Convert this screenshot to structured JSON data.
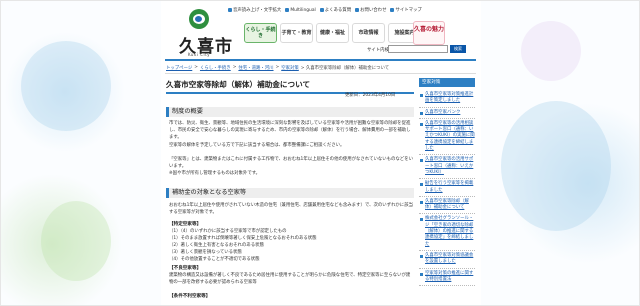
{
  "header": {
    "top_links": [
      {
        "icon": "square-icon",
        "label": "音声読み上げ・文字拡大"
      },
      {
        "icon": "square-icon",
        "label": "Multilingual"
      },
      {
        "icon": "square-icon",
        "label": "よくある質問"
      },
      {
        "icon": "square-icon",
        "label": "お問い合わせ"
      },
      {
        "icon": "square-icon",
        "label": "サイトマップ"
      }
    ],
    "logo": {
      "name": "久喜市",
      "sub": "Kuki City"
    },
    "nav": [
      "くらし・手続き",
      "子育て・教育",
      "健康・福祉",
      "市政情報",
      "施設案内"
    ],
    "miryoku": "久喜の魅力",
    "search": {
      "label": "サイト内検索",
      "button": "検索",
      "value": ""
    }
  },
  "breadcrumb": [
    {
      "label": "トップページ",
      "link": true
    },
    {
      "label": ">",
      "link": false
    },
    {
      "label": "くらし・手続き",
      "link": true
    },
    {
      "label": ">",
      "link": false
    },
    {
      "label": "住宅・道路・河川",
      "link": true
    },
    {
      "label": ">",
      "link": false
    },
    {
      "label": "空家対策",
      "link": true
    },
    {
      "label": "> 久喜市空家等除却（解体）補助金について",
      "link": false
    }
  ],
  "main": {
    "title": "久喜市空家等除却（解体）補助金について",
    "updated": "更新日：2023年4月10日",
    "section1": {
      "heading": "制度の概要",
      "p1": "市では、防災、衛生、景観等、地域住民の生活環境に深刻な影響を及ぼしている空家等や活用が困難な空家等の除却を促進し、市民の安全で安心な暮らしの実現に寄与するため、市内の空家等の除却（解体）を行う場合、解体費用の一部を補助します。",
      "p2": "空家等の解体を予定している方で下記に該当する場合は、都市整備課にご相談ください。",
      "p3": "「空家等」とは、建築物またはこれに付属する工作物で、おおむね1年以上居住その他の使用がなされていないものなどをいいます。",
      "p4": "※国や市が所有し管理するものは対象外です。"
    },
    "section2": {
      "heading": "補助金の対象となる空家等",
      "lead": "おおむね1年以上居住や使用がされていない木造の住宅（兼用住宅、店舗兼用住宅なども含みます）で、次のいずれかに該当する空家等が対象です。",
      "sub1": "【特定空家等】",
      "items": [
        "（1）（4）のいずれかに該当する空家等で市が認定したもの",
        "（1）そのまま放置すれば倒壊等著しく保安上危険となるおそれのある状態",
        "（2）著しく衛生上有害となるおそれのある状態",
        "（3）著しく景観を損なっている状態",
        "（4）その他放置することが不適切である状態"
      ],
      "sub2": "【不良空家等】",
      "p5": "建築物の構造又は設備が著しく不良であるため居住用に使用することが明らかに危険な住宅で、特定空家等に至らないが建物の一部を改修する必要が認められる空家等",
      "sub3": "【条件不利空家等】"
    }
  },
  "side": {
    "heading": "空家対策",
    "items": [
      "久喜市空家等対策推進計画を策定しました",
      "久喜市空家バンク",
      "久喜市空家等の活用相談サポート窓口（通称：いえかつKUKI）の実施に関する連携協定を締結しました",
      "久喜市空家等の活用サポート窓口（通称：いえかつKUKI）",
      "勧告を行う空家等を掲載しました",
      "久喜市空家等除却（解体）補助金について",
      "株式会社グランソール・ジ「空き家の適切な除却（解体）の推進に関する連携協定」を締結しました",
      "久喜市空家等対策協議会を設置しました",
      "空家等対策の推進に関する特別措置法"
    ]
  },
  "colors": {
    "accent": "#2d7fc3",
    "link": "#1c5fb0",
    "green": "#2f8f3f",
    "pink": "#b7213a"
  }
}
